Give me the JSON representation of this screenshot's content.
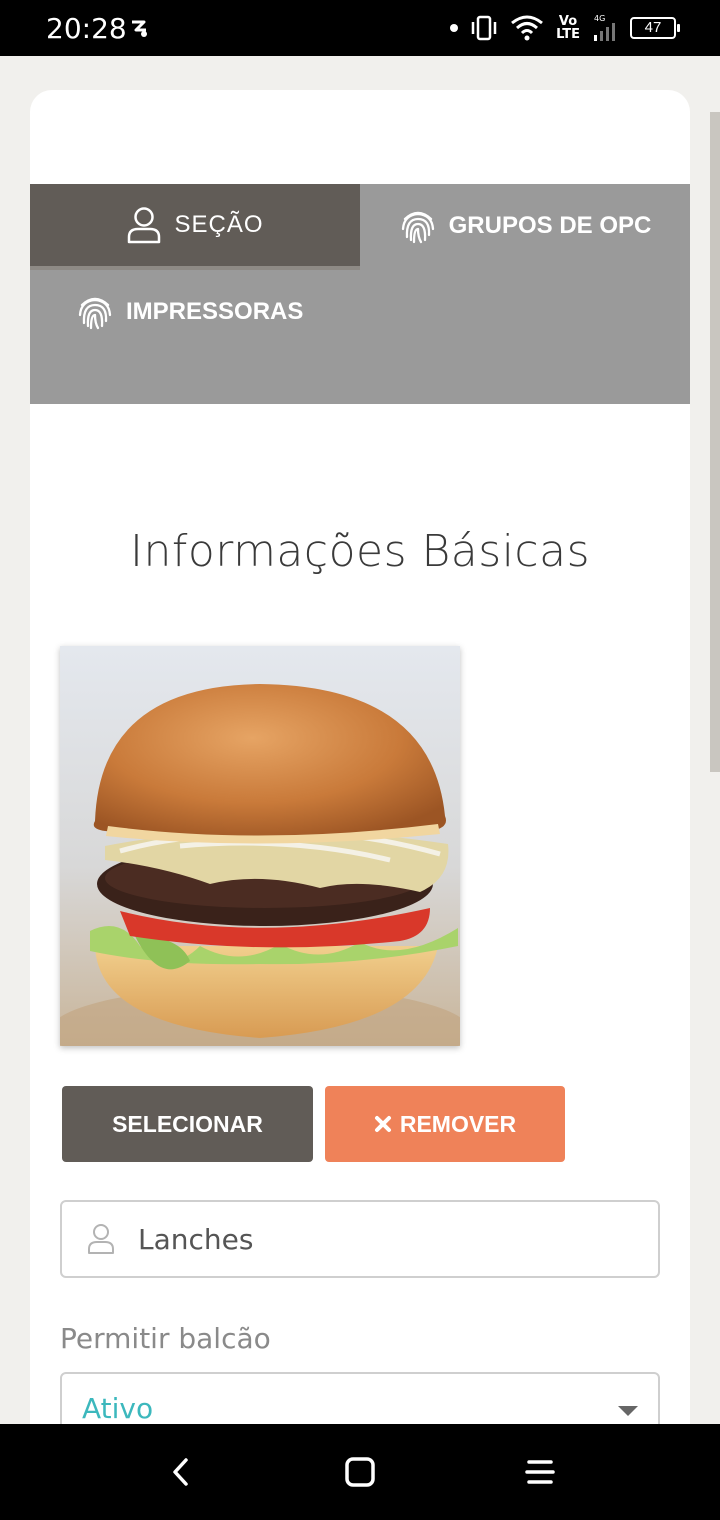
{
  "status_bar": {
    "time": "20:28",
    "network_label": "Vo\nLTE",
    "network_gen": "4G",
    "battery": "47"
  },
  "tabs": [
    {
      "label": "SEÇÃO",
      "icon": "user-icon",
      "active": true
    },
    {
      "label": "GRUPOS DE OPC",
      "icon": "fingerprint-icon",
      "active": false
    },
    {
      "label": "IMPRESSORAS",
      "icon": "fingerprint-icon",
      "active": false
    }
  ],
  "section": {
    "title": "Informações Básicas"
  },
  "image": {
    "subject": "burger-photo"
  },
  "buttons": {
    "select_label": "SELECIONAR",
    "remove_label": "REMOVER",
    "remove_icon": "close-icon"
  },
  "name_field": {
    "value": "Lanches",
    "icon": "user-icon"
  },
  "counter_field": {
    "label": "Permitir balcão",
    "value": "Ativo"
  },
  "colors": {
    "active_tab": "#615c57",
    "tab_bar": "#9a9a9a",
    "select_button": "#615c57",
    "remove_button": "#ef8259",
    "select_value_text": "#3cb8bd"
  }
}
